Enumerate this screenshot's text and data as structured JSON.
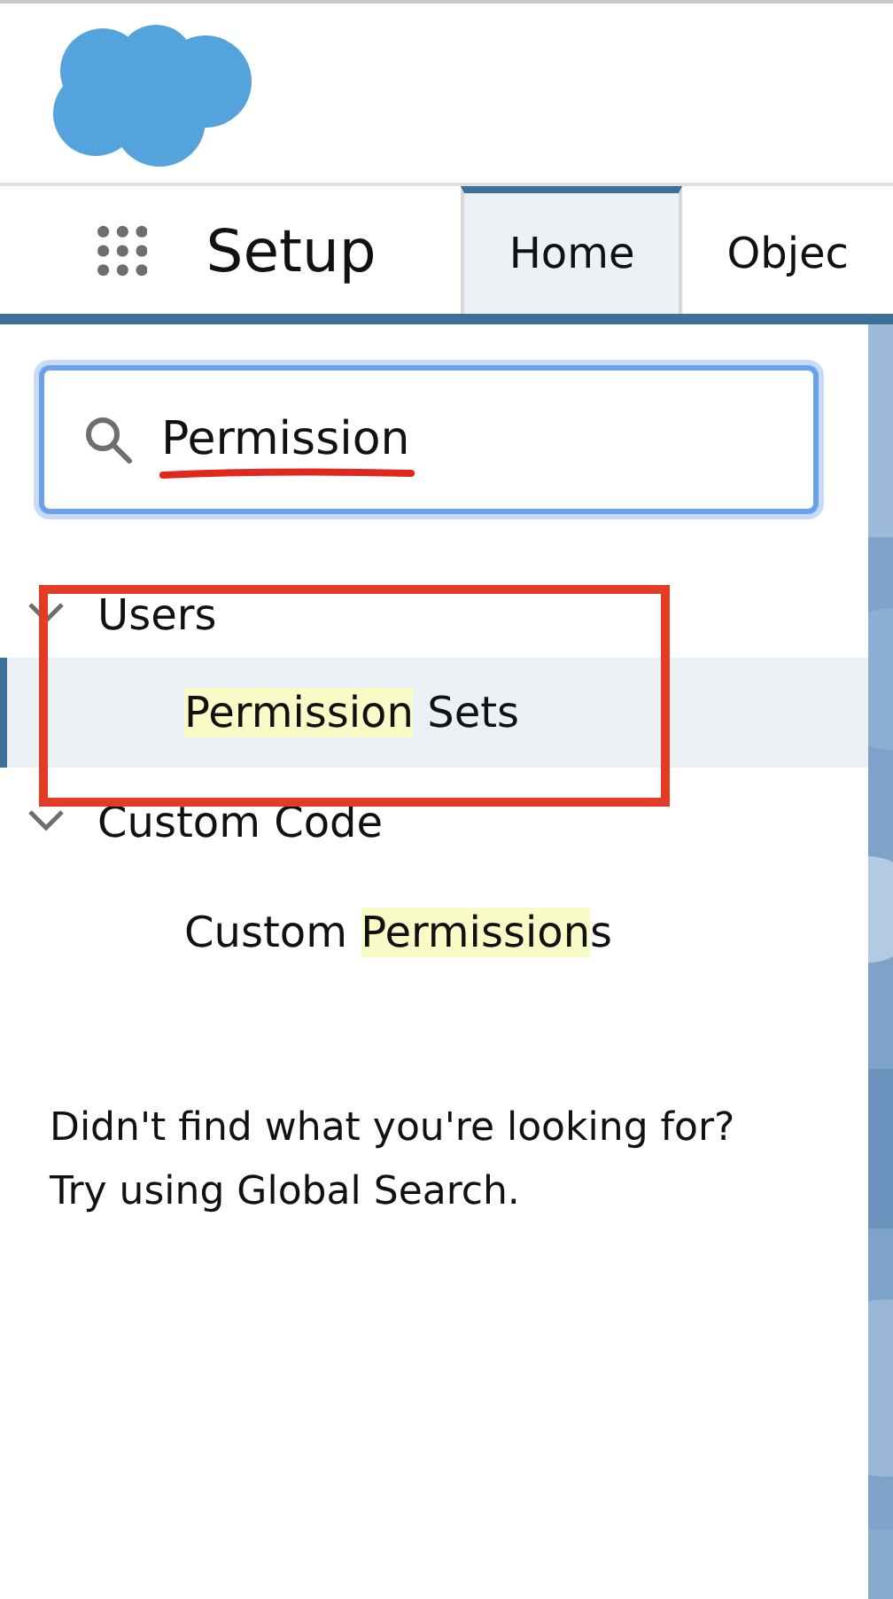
{
  "nav": {
    "app_title": "Setup",
    "tabs": [
      {
        "label": "Home",
        "selected": true
      },
      {
        "label": "Objec",
        "selected": false
      }
    ]
  },
  "search": {
    "value": "Permission"
  },
  "tree": [
    {
      "label": "Users",
      "expanded": true,
      "children": [
        {
          "selected": true,
          "segments": [
            {
              "text": "Permission",
              "highlighted": true
            },
            {
              "text": " Sets",
              "highlighted": false
            }
          ]
        }
      ]
    },
    {
      "label": "Custom Code",
      "expanded": true,
      "children": [
        {
          "selected": false,
          "segments": [
            {
              "text": "Custom ",
              "highlighted": false
            },
            {
              "text": "Permission",
              "highlighted": true
            },
            {
              "text": "s",
              "highlighted": false
            }
          ]
        }
      ]
    }
  ],
  "message": [
    "Didn't find what you're looking for?",
    "Try using Global Search."
  ],
  "annotations": {
    "search_underline": true,
    "selection_box": true
  }
}
